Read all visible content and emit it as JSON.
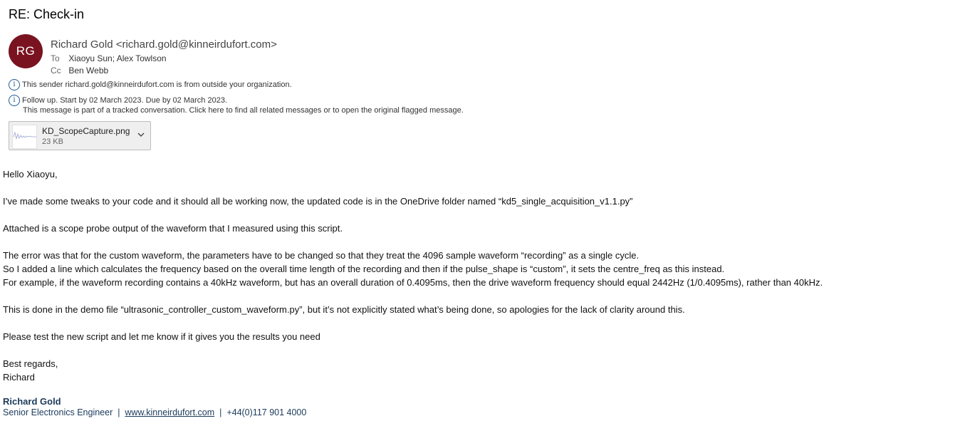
{
  "email": {
    "subject": "RE: Check-in",
    "avatar_initials": "RG",
    "avatar_color": "#7a1320",
    "sender": "Richard Gold <richard.gold@kinneirdufort.com>",
    "to_label": "To",
    "to": "Xiaoyu Sun; Alex Towlson",
    "cc_label": "Cc",
    "cc": "Ben Webb",
    "external_notice": "This sender richard.gold@kinneirdufort.com is from outside your organization.",
    "follow_up": "Follow up.  Start by 02 March 2023.  Due by 02 March 2023.",
    "tracked_notice": "This message is part of a tracked conversation. Click here to find all related messages or to open the original flagged message."
  },
  "attachment": {
    "name": "KD_ScopeCapture.png",
    "size": "23 KB"
  },
  "body": {
    "greeting": "Hello Xiaoyu,",
    "p1": "I’ve made some tweaks to your code and it should all be working now, the updated code is in the OneDrive folder named “kd5_single_acquisition_v1.1.py”",
    "p2": "Attached is a scope probe output of the waveform that I measured using this script.",
    "p3_l1": "The error was that for the custom waveform, the parameters have to be changed so that they treat the 4096 sample waveform “recording” as a single cycle.",
    "p3_l2": "So I added a line which calculates the frequency based on the overall time length of the recording and then if the pulse_shape is “custom”, it sets the centre_freq as this instead.",
    "p3_l3": "For example, if the waveform recording contains a 40kHz waveform, but has an overall duration of 0.4095ms, then the drive waveform frequency should equal 2442Hz (1/0.4095ms), rather than 40kHz.",
    "p4": "This is done in the demo file “ultrasonic_controller_custom_waveform.py”, but it’s not explicitly stated what’s being done, so apologies for the lack of clarity around this.",
    "p5": "Please test the new script and let me know if it gives you the results you need",
    "closing": "Best regards,",
    "name": "Richard"
  },
  "signature": {
    "name": "Richard Gold",
    "title": "Senior Electronics Engineer",
    "sep": "|",
    "website": "www.kinneirdufort.com",
    "phone": "+44(0)117 901 4000"
  }
}
